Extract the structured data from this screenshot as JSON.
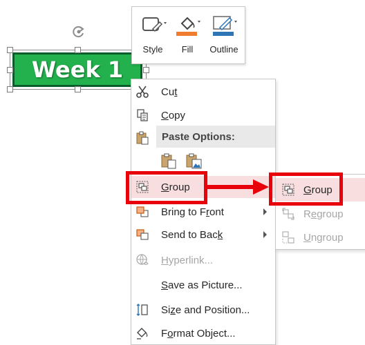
{
  "shape": {
    "text": "Week 1",
    "fill": "#22b14c",
    "border": "#0a5d2a"
  },
  "mini_toolbar": {
    "buttons": [
      {
        "label": "Style",
        "icon": "style-shape-icon"
      },
      {
        "label": "Fill",
        "icon": "fill-bucket-icon",
        "color": "#f07c30"
      },
      {
        "label": "Outline",
        "icon": "outline-pen-icon",
        "color": "#2e75b6"
      }
    ]
  },
  "context_menu": {
    "cut": {
      "label_pre": "Cu",
      "label_key": "t",
      "label_post": ""
    },
    "copy": {
      "label_pre": "",
      "label_key": "C",
      "label_post": "opy"
    },
    "paste_header": "Paste Options:",
    "group": {
      "label_pre": "",
      "label_key": "G",
      "label_post": "roup"
    },
    "bring_to_front": {
      "label_pre": "Bring to F",
      "label_key": "r",
      "label_post": "ont"
    },
    "send_to_back": {
      "label_pre": "Send to Bac",
      "label_key": "k",
      "label_post": ""
    },
    "hyperlink": {
      "label_pre": "",
      "label_key": "H",
      "label_post": "yperlink..."
    },
    "save_as_picture": {
      "label_pre": "",
      "label_key": "S",
      "label_post": "ave as Picture..."
    },
    "size_and_position": {
      "label_pre": "Si",
      "label_key": "z",
      "label_post": "e and Position..."
    },
    "format_object": {
      "label_pre": "F",
      "label_key": "o",
      "label_post": "rmat Object..."
    }
  },
  "submenu": {
    "group": {
      "label_pre": "",
      "label_key": "G",
      "label_post": "roup"
    },
    "regroup": {
      "label_pre": "R",
      "label_key": "e",
      "label_post": "group"
    },
    "ungroup": {
      "label_pre": "",
      "label_key": "U",
      "label_post": "ngroup"
    }
  },
  "colors": {
    "annotation_red": "#e8000b",
    "hover_pink": "#f8dede"
  }
}
